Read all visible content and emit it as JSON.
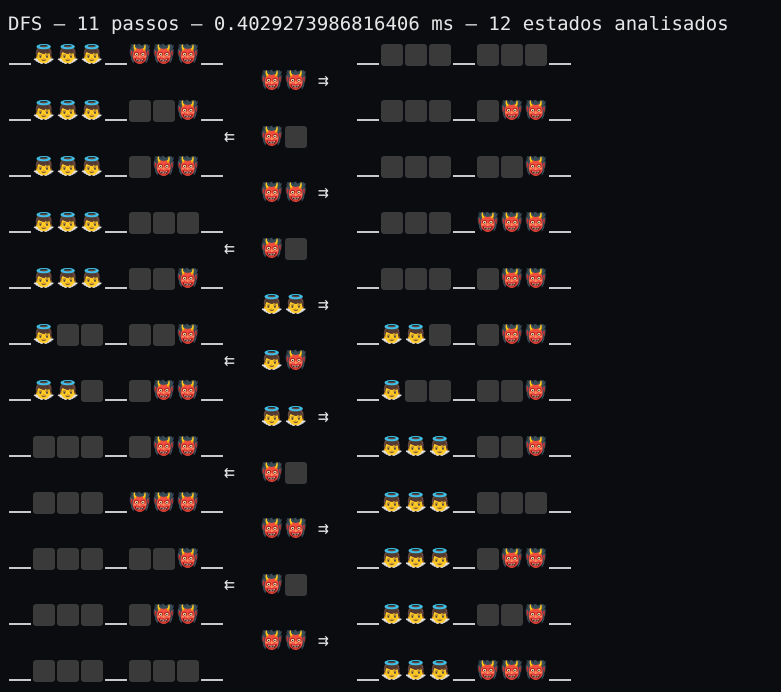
{
  "title": "DFS – 11 passos – 0.4029273986816406 ms – 12 estados analisados",
  "glyphs": {
    "angel": "👼",
    "devil": "👹",
    "empty": "⬛",
    "arrow_right": "⇉",
    "arrow_left": "⇇"
  },
  "steps": [
    {
      "left": "_AAA_DDD_",
      "boat": "DD",
      "dir": "right",
      "right": "_EEE_EEE_"
    },
    {
      "left": "_AAA_EED_",
      "boat": "DE",
      "dir": "left",
      "right": "_EEE_EDD_"
    },
    {
      "left": "_AAA_EDD_",
      "boat": "DD",
      "dir": "right",
      "right": "_EEE_EED_"
    },
    {
      "left": "_AAA_EEE_",
      "boat": "DE",
      "dir": "left",
      "right": "_EEE_DDD_"
    },
    {
      "left": "_AAA_EED_",
      "boat": "AA",
      "dir": "right",
      "right": "_EEE_EDD_"
    },
    {
      "left": "_AEE_EED_",
      "boat": "AD",
      "dir": "left",
      "right": "_AAE_EDD_"
    },
    {
      "left": "_AAE_EDD_",
      "boat": "AA",
      "dir": "right",
      "right": "_AEE_EED_"
    },
    {
      "left": "_EEE_EDD_",
      "boat": "DE",
      "dir": "left",
      "right": "_AAA_EED_"
    },
    {
      "left": "_EEE_DDD_",
      "boat": "DD",
      "dir": "right",
      "right": "_AAA_EEE_"
    },
    {
      "left": "_EEE_EED_",
      "boat": "DE",
      "dir": "left",
      "right": "_AAA_EDD_"
    },
    {
      "left": "_EEE_EDD_",
      "boat": "DD",
      "dir": "right",
      "right": "_AAA_EED_"
    },
    {
      "left": "_EEE_EEE_",
      "boat": "",
      "dir": "",
      "right": "_AAA_DDD_"
    }
  ]
}
